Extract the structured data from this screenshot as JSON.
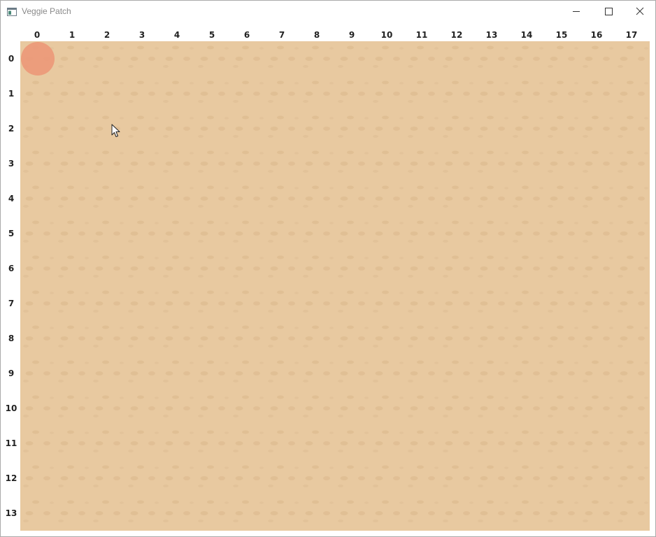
{
  "window": {
    "title": "Veggie Patch",
    "controls": {
      "minimize": "minimize-icon",
      "maximize": "maximize-icon",
      "close": "close-icon"
    }
  },
  "grid": {
    "columns": [
      "0",
      "1",
      "2",
      "3",
      "4",
      "5",
      "6",
      "7",
      "8",
      "9",
      "10",
      "11",
      "12",
      "13",
      "14",
      "15",
      "16",
      "17"
    ],
    "rows": [
      "0",
      "1",
      "2",
      "3",
      "4",
      "5",
      "6",
      "7",
      "8",
      "9",
      "10",
      "11",
      "12",
      "13"
    ],
    "soil_color": "#e8c9a0",
    "marker": {
      "row": 0,
      "col": 0,
      "color": "#ec9878"
    }
  },
  "cursor": {
    "icon": "pointer-arrow-icon"
  }
}
